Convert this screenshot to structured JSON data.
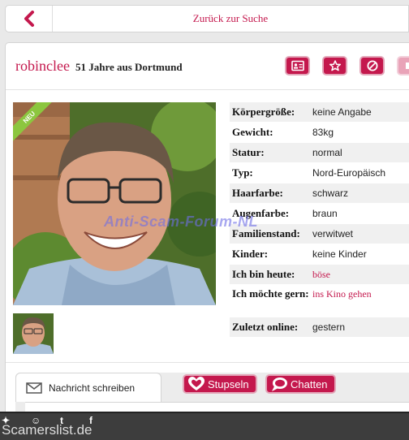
{
  "topbar": {
    "back_label": "Zurück zur Suche"
  },
  "profile": {
    "username": "robinclee",
    "meta": "51 Jahre aus Dortmund",
    "badge": "NEU",
    "actions": [
      "vcard-icon",
      "star-icon",
      "block-icon",
      "more-icon"
    ]
  },
  "details": [
    {
      "label": "Körpergröße:",
      "value": "keine Angabe"
    },
    {
      "label": "Gewicht:",
      "value": "83kg"
    },
    {
      "label": "Statur:",
      "value": "normal"
    },
    {
      "label": "Typ:",
      "value": "Nord-Europäisch"
    },
    {
      "label": "Haarfarbe:",
      "value": "schwarz"
    },
    {
      "label": "Augenfarbe:",
      "value": "braun"
    },
    {
      "label": "Familienstand:",
      "value": "verwitwet"
    },
    {
      "label": "Kinder:",
      "value": "keine Kinder"
    },
    {
      "label": "Ich bin heute:",
      "value": "böse"
    },
    {
      "label": "Ich möchte gern:",
      "value": "ins Kino gehen"
    },
    {
      "label": "Zuletzt online:",
      "value": "gestern"
    }
  ],
  "watermark": "Anti-Scam-Forum-NL",
  "tabs": {
    "message": "Nachricht schreiben",
    "stupseln": "Stupseln",
    "chatten": "Chatten"
  },
  "footer": {
    "site": "Scamerslist.de"
  },
  "colors": {
    "accent": "#c4184d",
    "badge": "#8cc63f"
  }
}
